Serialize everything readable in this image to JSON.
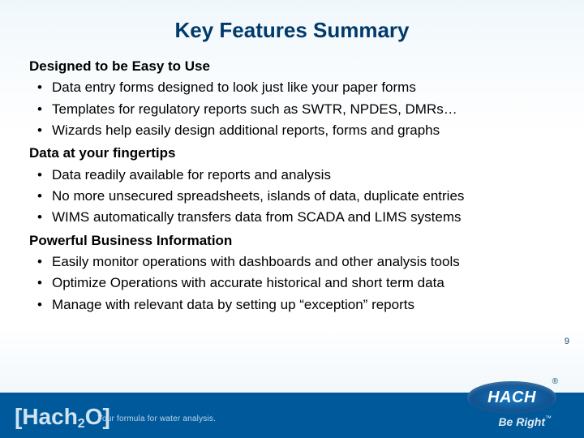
{
  "title": "Key Features Summary",
  "sections": [
    {
      "heading": "Designed to be Easy to Use",
      "bullets": [
        "Data entry forms designed to look just like your paper forms",
        "Templates for regulatory reports such as SWTR, NPDES, DMRs…",
        "Wizards help easily design additional reports, forms and graphs"
      ]
    },
    {
      "heading": "Data at your fingertips",
      "bullets": [
        "Data readily available for reports and analysis",
        "No more unsecured spreadsheets, islands of data, duplicate entries",
        "WIMS automatically transfers data from SCADA and LIMS systems"
      ]
    },
    {
      "heading": "Powerful Business Information",
      "bullets": [
        "Easily monitor operations with dashboards and other analysis tools",
        "Optimize Operations with accurate historical and short term data",
        "Manage with relevant data by setting up “exception” reports"
      ]
    }
  ],
  "page_number": "9",
  "footer": {
    "brand_left_prefix": "[Hach",
    "brand_left_sub": "2",
    "brand_left_suffix": "O]",
    "tagline": "Your formula for water analysis.",
    "logo_text": "HACH",
    "registered": "®",
    "slogan": "Be Right",
    "tm": "™"
  }
}
